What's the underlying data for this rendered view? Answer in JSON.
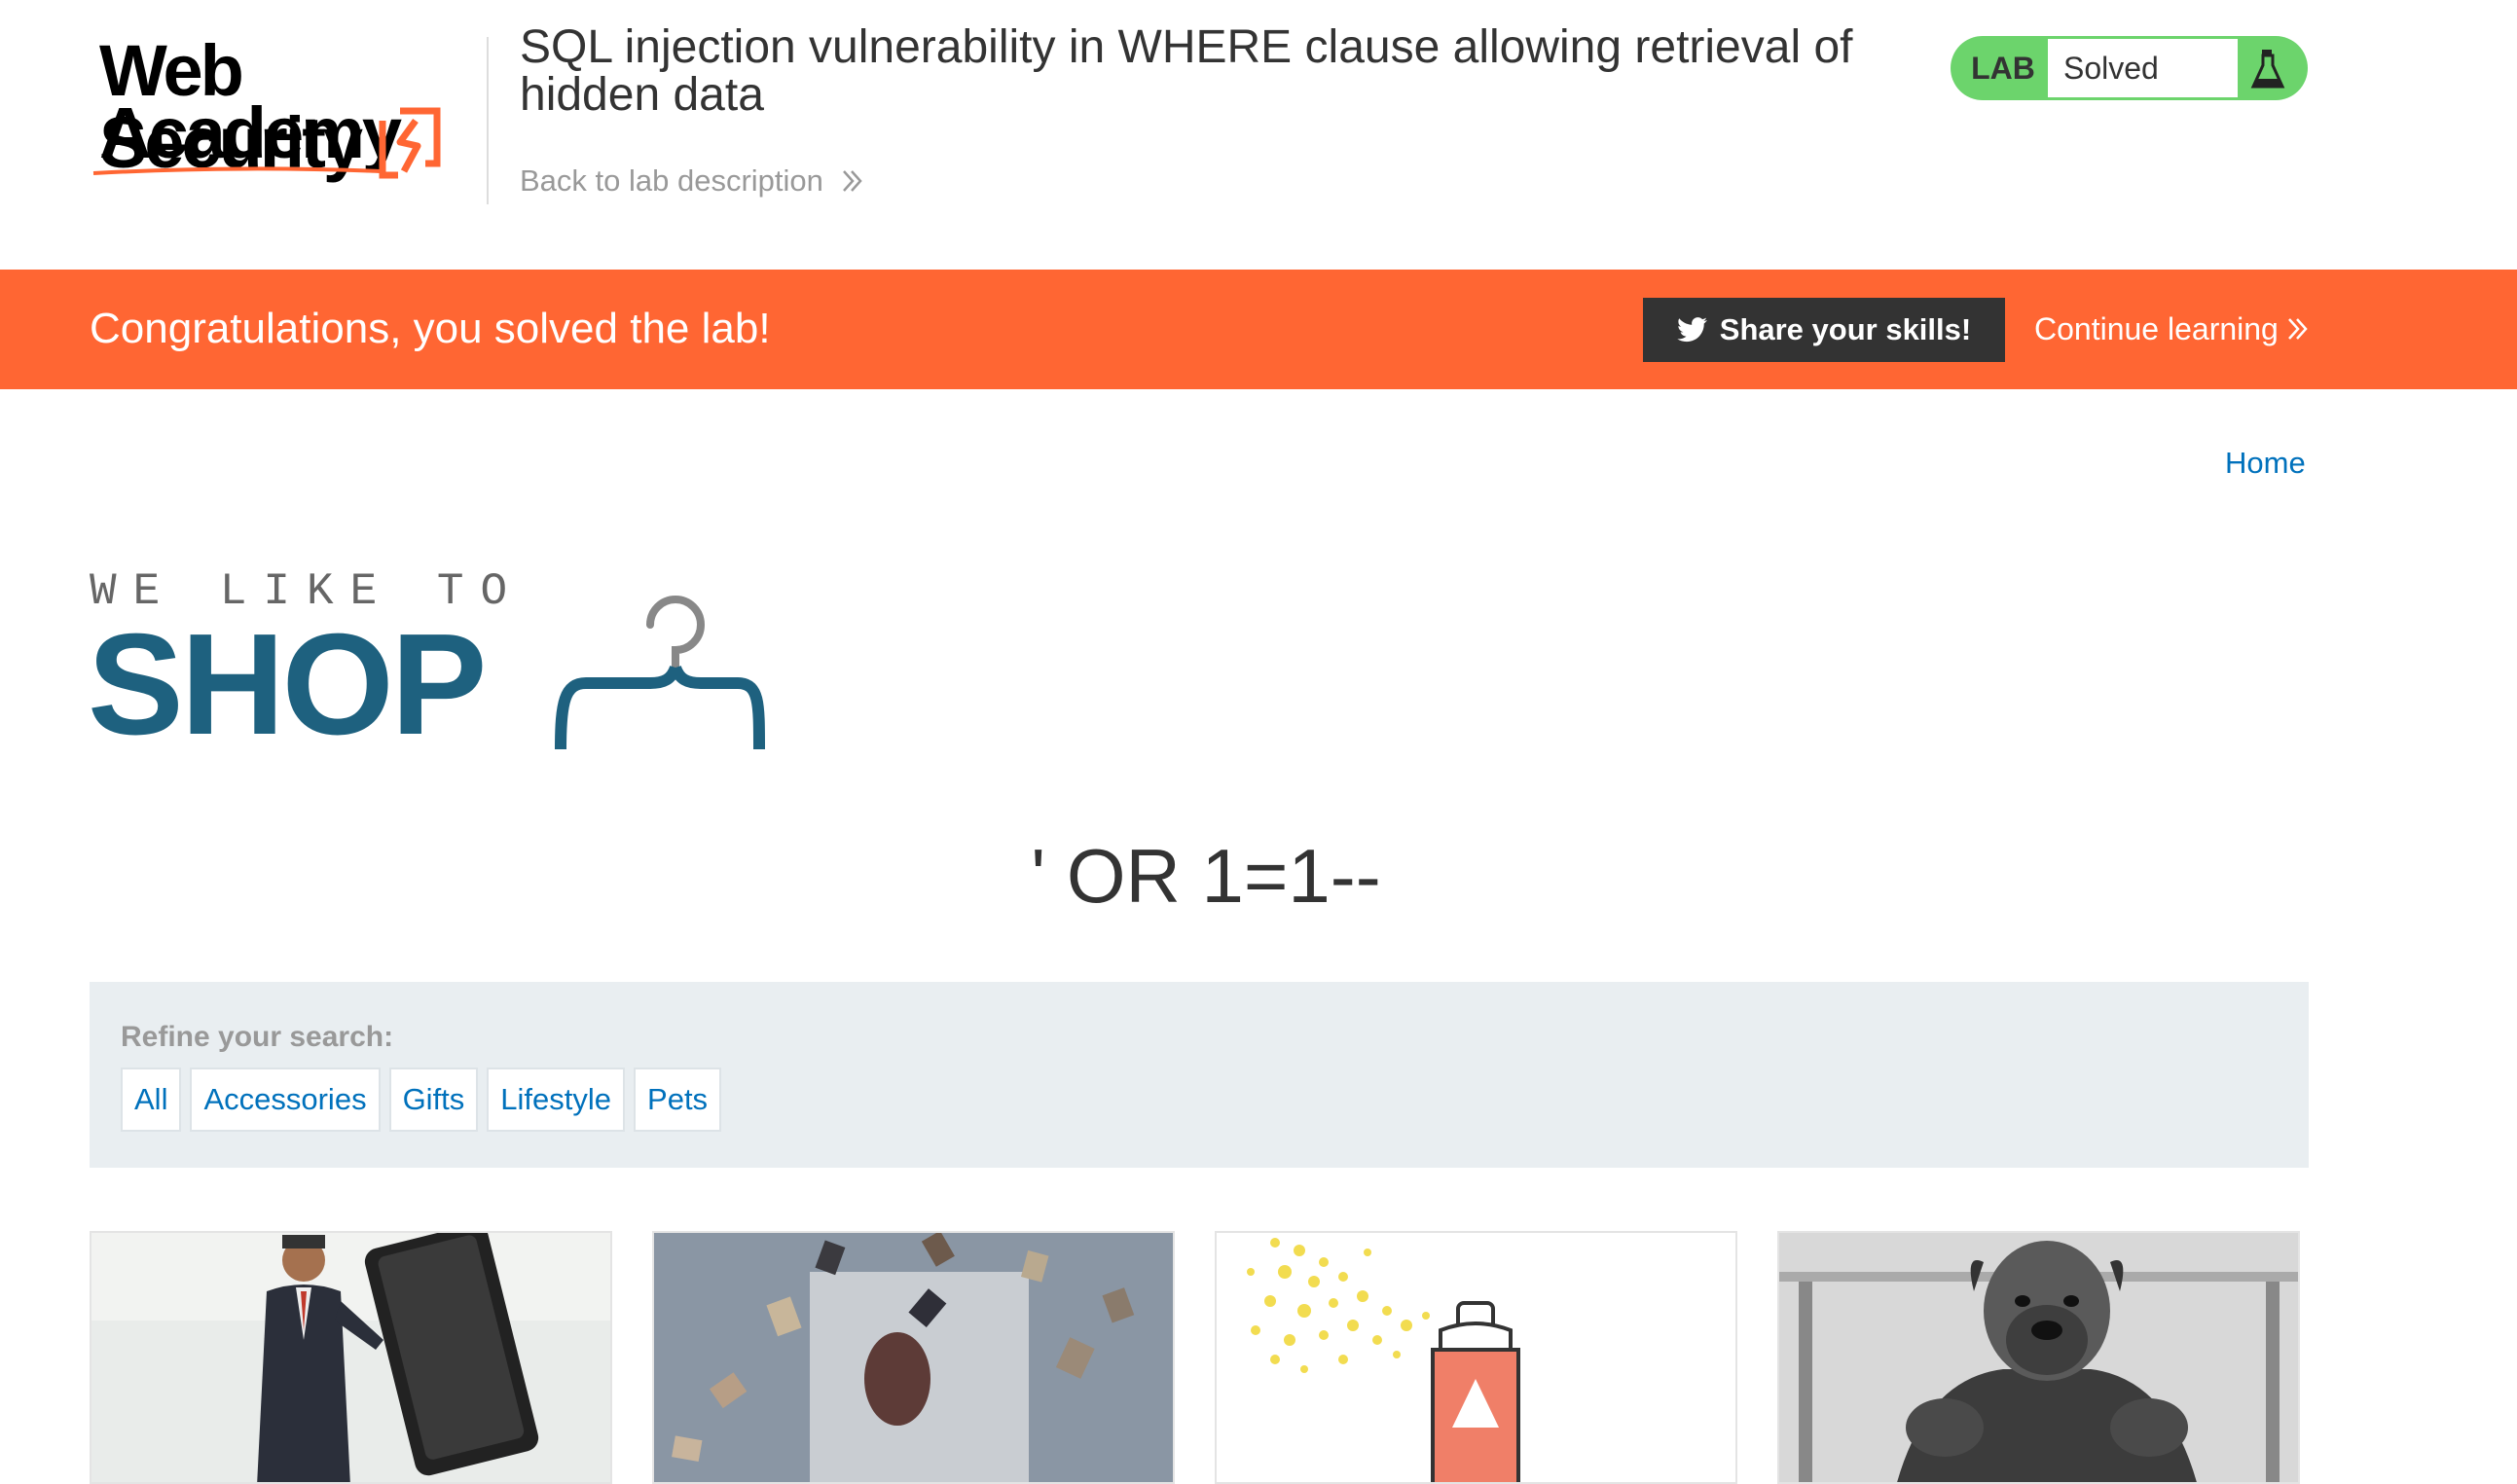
{
  "header": {
    "logo_line1": "Web Security",
    "logo_line2": "Academy",
    "lab_title": "SQL injection vulnerability in WHERE clause allowing retrieval of hidden data",
    "back_link": "Back to lab description",
    "lab_label": "LAB",
    "lab_status": "Solved"
  },
  "banner": {
    "message": "Congratulations, you solved the lab!",
    "share_button": "Share your skills!",
    "continue_link": "Continue learning"
  },
  "nav": {
    "home": "Home"
  },
  "shop_logo": {
    "tagline": "WE LIKE TO",
    "name": "SHOP"
  },
  "search_heading": "' OR 1=1--",
  "filters": {
    "label": "Refine your search:",
    "items": [
      "All",
      "Accessories",
      "Gifts",
      "Lifestyle",
      "Pets"
    ]
  },
  "colors": {
    "accent_orange": "#ff6633",
    "lab_green": "#6cd46c",
    "link_blue": "#0071bc",
    "shop_blue": "#1e617f"
  }
}
